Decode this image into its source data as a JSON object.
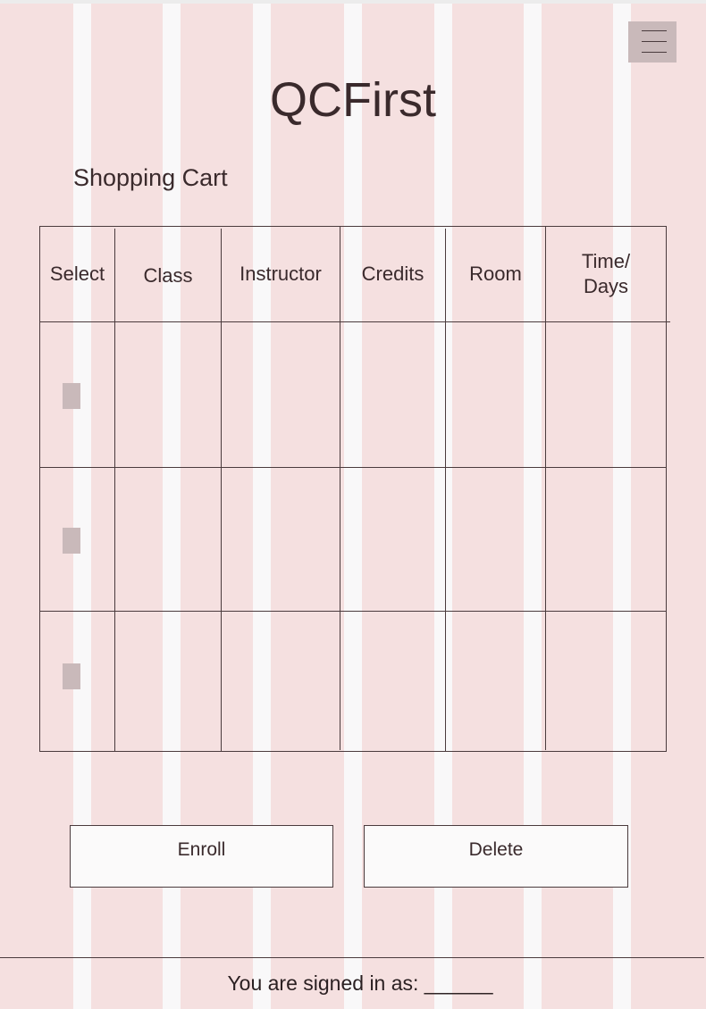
{
  "app": {
    "title": "QCFirst",
    "menu_icon": "hamburger-menu-icon"
  },
  "cart": {
    "heading": "Shopping Cart",
    "columns": [
      "Select",
      "Class",
      "Instructor",
      "Credits",
      "Room",
      "Time/\nDays"
    ],
    "rows": [
      {
        "selected": false,
        "class": "",
        "instructor": "",
        "credits": "",
        "room": "",
        "time_days": ""
      },
      {
        "selected": false,
        "class": "",
        "instructor": "",
        "credits": "",
        "room": "",
        "time_days": ""
      },
      {
        "selected": false,
        "class": "",
        "instructor": "",
        "credits": "",
        "room": "",
        "time_days": ""
      }
    ]
  },
  "actions": {
    "enroll_label": "Enroll",
    "delete_label": "Delete"
  },
  "footer": {
    "signed_in_text": "You are signed in as: ______"
  },
  "colors": {
    "background": "#f5e0e0",
    "guide": "#f9f8f9",
    "text": "#3a2a2c",
    "checkbox": "#c9b9ba"
  }
}
